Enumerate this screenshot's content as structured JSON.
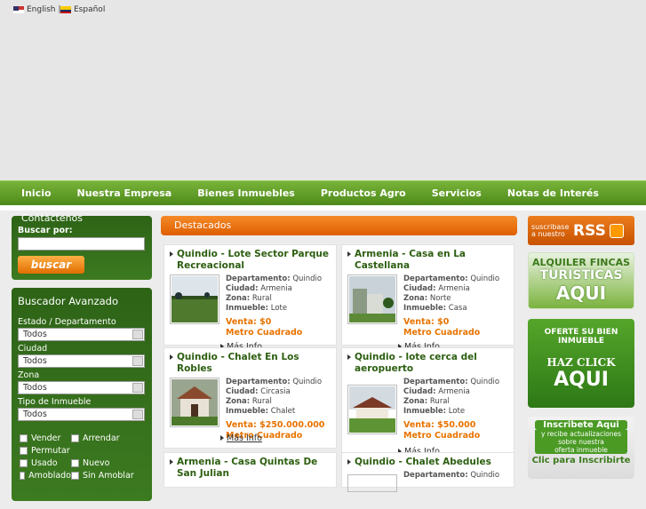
{
  "header": {
    "lang_en": "English",
    "separator": "|",
    "lang_es": "Español"
  },
  "nav": [
    "Inicio",
    "Nuestra Empresa",
    "Bienes Inmuebles",
    "Productos Agro",
    "Servicios",
    "Notas de Interés"
  ],
  "contact": {
    "title": "Contactenos",
    "search_label": "Buscar por:",
    "button": "buscar"
  },
  "advanced": {
    "title": "Buscador Avanzado",
    "fields": [
      {
        "label": "Estado / Departamento",
        "value": "Todos"
      },
      {
        "label": "Ciudad",
        "value": "Todos"
      },
      {
        "label": "Zona",
        "value": "Todos"
      },
      {
        "label": "Tipo de Inmueble",
        "value": "Todos"
      }
    ],
    "checks": [
      "Vender",
      "Arrendar",
      "Permutar",
      "Usado",
      "Nuevo",
      "Amoblado",
      "Sin Amoblar"
    ]
  },
  "featured": {
    "title": "Destacados",
    "more": "Más Info",
    "labels": {
      "dep": "Departamento:",
      "city": "Ciudad:",
      "zone": "Zona:",
      "type": "Inmueble:"
    },
    "items": [
      {
        "title": "Quindio - Lote Sector Parque Recreacional",
        "dep": "Quindio",
        "city": "Armenia",
        "zone": "Rural",
        "type": "Lote",
        "price": "Venta: $0",
        "unit": "Metro Cuadrado"
      },
      {
        "title": "Armenia - Casa en La Castellana",
        "dep": "Quindio",
        "city": "Armenia",
        "zone": "Norte",
        "type": "Casa",
        "price": "Venta: $0",
        "unit": "Metro Cuadrado"
      },
      {
        "title": "Quindio - Chalet En Los Robles",
        "dep": "Quindio",
        "city": "Circasia",
        "zone": "Rural",
        "type": "Chalet",
        "price": "Venta: $250.000.000",
        "unit": "Metro Cuadrado"
      },
      {
        "title": "Quindio - lote cerca del aeropuerto",
        "dep": "Quindio",
        "city": "Armenia",
        "zone": "Rural",
        "type": "Lote",
        "price": "Venta: $50.000",
        "unit": "Metro Cuadrado"
      },
      {
        "title": "Armenia - Casa Quintas De San Julian"
      },
      {
        "title": "Quindio - Chalet Abedules",
        "dep": "Quindio"
      }
    ]
  },
  "sidebar": {
    "rss_text": "suscribase a nuestro",
    "rss_label": "RSS",
    "banner1": [
      "ALQUILER FINCAS",
      "TURISTICAS",
      "AQUI"
    ],
    "banner2": [
      "OFERTE SU BIEN",
      "INMUEBLE",
      "HAZ CLICK",
      "AQUI"
    ],
    "banner3": [
      "Inscribete Aqui",
      "y recibe actualizaciones",
      "sobre nuestra",
      "oferta inmueble",
      "Clic para Inscribirte"
    ]
  }
}
